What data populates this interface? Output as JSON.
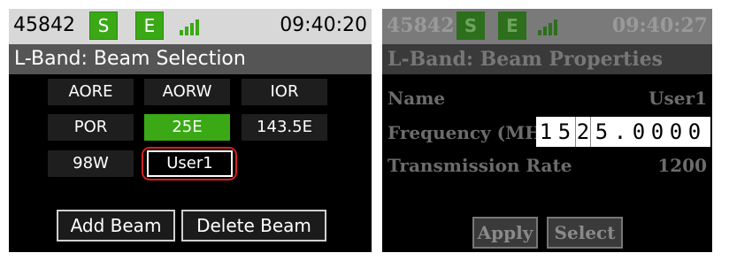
{
  "left_screen": {
    "status": {
      "id": "45842",
      "badge_s": "S",
      "badge_e": "E",
      "time": "09:40:20",
      "signal_bars": 4
    },
    "title": "L-Band: Beam Selection",
    "beams": [
      "AORE",
      "AORW",
      "IOR",
      "POR",
      "25E",
      "143.5E",
      "98W",
      "User1"
    ],
    "selected_beam": "25E",
    "highlighted_beam": "User1",
    "buttons": {
      "add": "Add Beam",
      "delete": "Delete Beam"
    },
    "colors": {
      "accent": "#3aa915",
      "highlight_circle": "#d62020"
    }
  },
  "right_screen": {
    "status": {
      "id": "45842",
      "badge_s": "S",
      "badge_e": "E",
      "time": "09:40:27",
      "signal_bars": 4
    },
    "title": "L-Band: Beam Properties",
    "rows": {
      "name_label": "Name",
      "name_value": "User1",
      "freq_label": "Frequency (MHz)",
      "rate_label": "Transmission Rate",
      "rate_value": "1200"
    },
    "frequency_digits": [
      "1",
      "5",
      "2",
      "5",
      ".",
      "0",
      "0",
      "0",
      "0"
    ],
    "cursor_digit_index": 2,
    "buttons": {
      "apply": "Apply",
      "select": "Select"
    }
  }
}
